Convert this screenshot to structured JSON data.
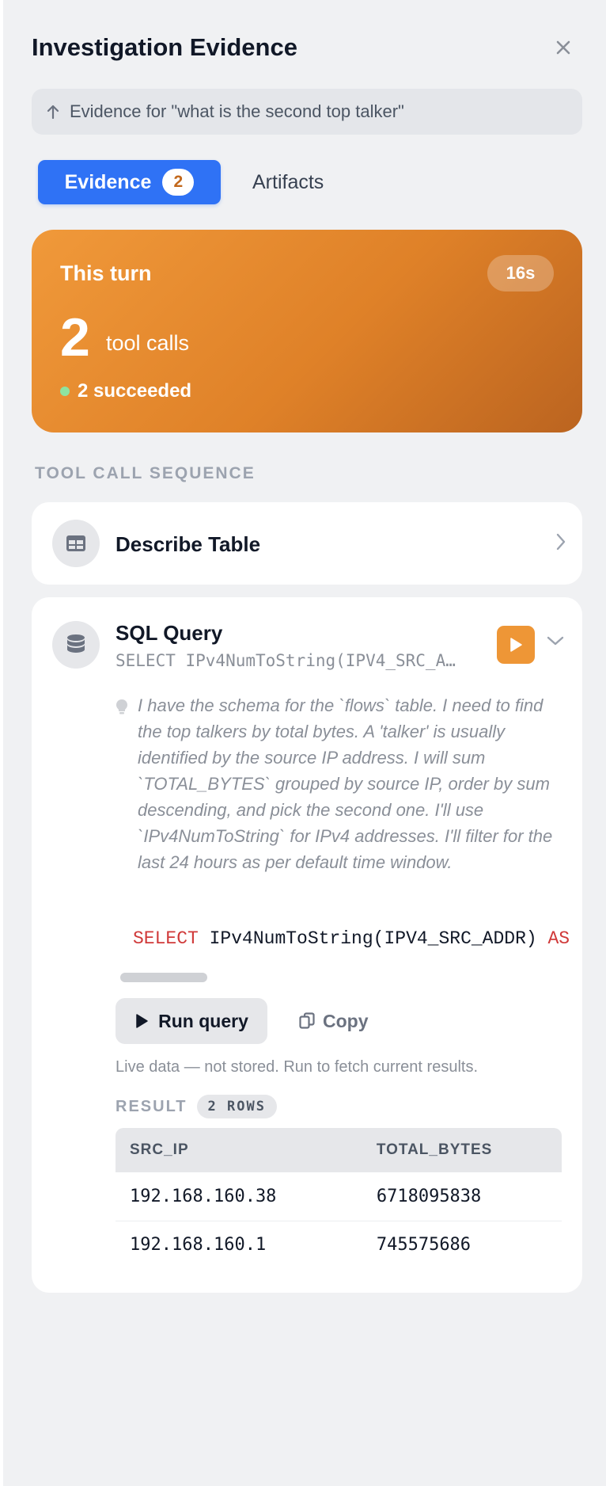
{
  "panel": {
    "title": "Investigation Evidence",
    "context": "Evidence for \"what is the second top talker\""
  },
  "tabs": {
    "evidence_label": "Evidence",
    "evidence_count": "2",
    "artifacts_label": "Artifacts",
    "active": "Evidence"
  },
  "turn": {
    "label": "This turn",
    "duration": "16s",
    "tool_calls": "2",
    "tool_calls_unit": "tool calls",
    "status": "2 succeeded",
    "status_color": "#8ee3a0",
    "accent_color": "#e08428"
  },
  "sequence": {
    "label": "TOOL CALL SEQUENCE",
    "items": [
      {
        "title": "Describe Table",
        "icon": "table-icon",
        "expanded": false
      },
      {
        "title": "SQL Query",
        "icon": "database-icon",
        "expanded": true,
        "preview": "SELECT IPv4NumToString(IPV4_SRC_A…",
        "reasoning": "I have the schema for the `flows` table. I need to find the top talkers by total bytes. A 'talker' is usually identified by the source IP address. I will sum `TOTAL_BYTES` grouped by source IP, order by sum descending, and pick the second one. I'll use `IPv4NumToString` for IPv4 addresses. I'll filter for the last 24 hours as per default time window.",
        "code_keyword": "SELECT",
        "code_rest": " IPv4NumToString(IPV4_SRC_ADDR) ",
        "code_tail": "AS src_ip",
        "run_label": "Run query",
        "copy_label": "Copy",
        "live_note": "Live data — not stored. Run to fetch current results.",
        "result_label": "RESULT",
        "rows_badge": "2 ROWS",
        "columns": [
          "SRC_IP",
          "TOTAL_BYTES"
        ],
        "rows": [
          [
            "192.168.160.38",
            "6718095838"
          ],
          [
            "192.168.160.1",
            "745575686"
          ]
        ]
      }
    ]
  }
}
